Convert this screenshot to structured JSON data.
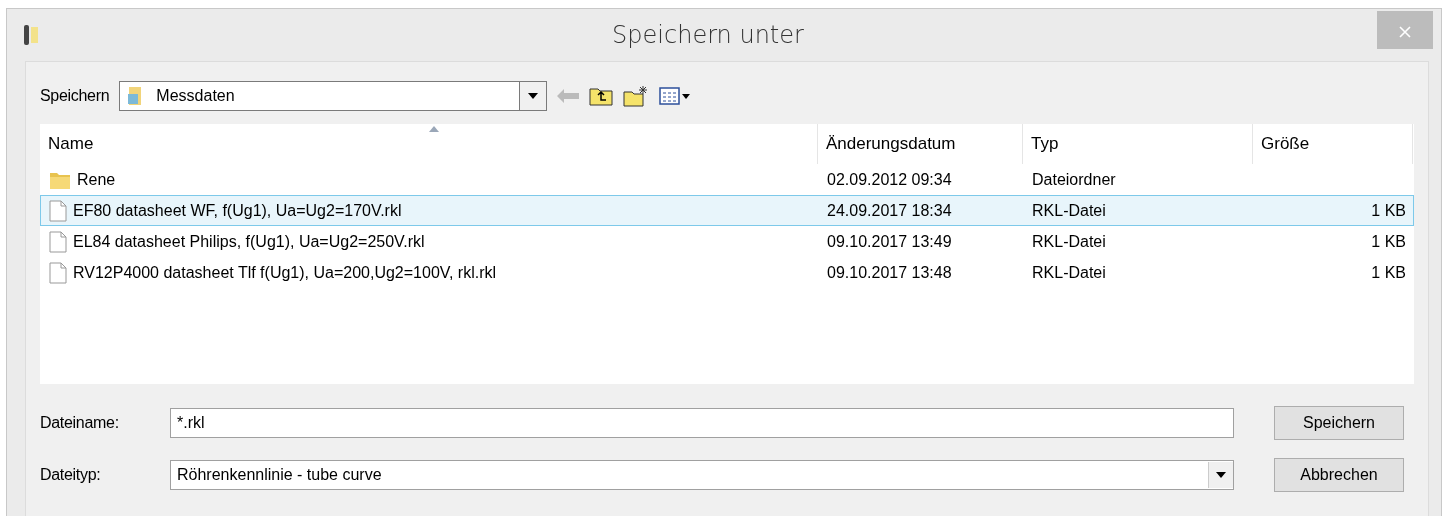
{
  "window": {
    "title": "Speichern unter"
  },
  "location": {
    "label": "Speichern",
    "value": "Messdaten"
  },
  "table": {
    "columns": [
      {
        "label": "Name",
        "sorted": true
      },
      {
        "label": "Änderungsdatum",
        "sorted": false
      },
      {
        "label": "Typ",
        "sorted": false
      },
      {
        "label": "Größe",
        "sorted": false
      }
    ],
    "rows": [
      {
        "kind": "folder",
        "name": "Rene",
        "date": "02.09.2012 09:34",
        "type": "Dateiordner",
        "size": "",
        "selected": false
      },
      {
        "kind": "file",
        "name": "EF80 datasheet WF,  f(Ug1), Ua=Ug2=170V.rkl",
        "date": "24.09.2017 18:34",
        "type": "RKL-Datei",
        "size": "1 KB",
        "selected": true
      },
      {
        "kind": "file",
        "name": "EL84 datasheet Philips, f(Ug1), Ua=Ug2=250V.rkl",
        "date": "09.10.2017 13:49",
        "type": "RKL-Datei",
        "size": "1 KB",
        "selected": false
      },
      {
        "kind": "file",
        "name": "RV12P4000 datasheet Tlf f(Ug1), Ua=200,Ug2=100V, rkl.rkl",
        "date": "09.10.2017 13:48",
        "type": "RKL-Datei",
        "size": "1 KB",
        "selected": false
      }
    ]
  },
  "filename": {
    "label": "Dateiname:",
    "value": "*.rkl"
  },
  "filetype": {
    "label": "Dateityp:",
    "value": "Röhrenkennlinie - tube curve"
  },
  "buttons": [
    "Speichern",
    "Abbrechen"
  ]
}
